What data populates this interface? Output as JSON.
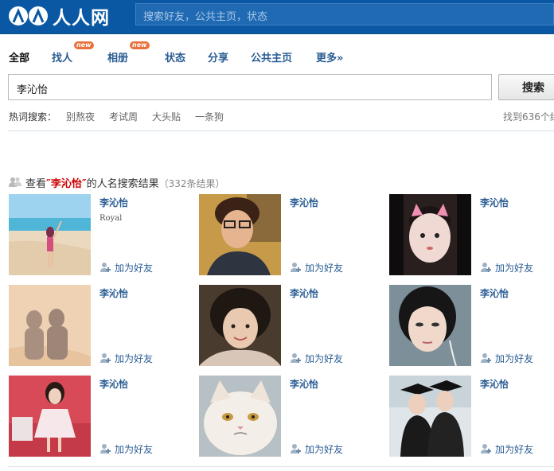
{
  "header": {
    "logo_text": "人人网",
    "search_placeholder": "搜索好友，公共主页，状态"
  },
  "tabs": [
    {
      "label": "全部",
      "active": true,
      "badge": ""
    },
    {
      "label": "找人",
      "active": false,
      "badge": "new"
    },
    {
      "label": "相册",
      "active": false,
      "badge": "new"
    },
    {
      "label": "状态",
      "active": false,
      "badge": ""
    },
    {
      "label": "分享",
      "active": false,
      "badge": ""
    },
    {
      "label": "公共主页",
      "active": false,
      "badge": ""
    },
    {
      "label": "更多»",
      "active": false,
      "badge": ""
    }
  ],
  "search": {
    "value": "李沁怡",
    "button_label": "搜索"
  },
  "hot": {
    "label": "热词搜索：",
    "words": [
      "别熬夜",
      "考试周",
      "大头贴",
      "一条狗"
    ],
    "found_text": "找到636个结"
  },
  "results": {
    "prefix": "查看",
    "name": "″李沁怡″",
    "suffix": "的人名搜索结果",
    "count": "（332条结果）"
  },
  "add_friend_label": "加为好友",
  "people": [
    {
      "name": "李沁怡",
      "subtitle": "Royal",
      "photo": "beach-girl-photo"
    },
    {
      "name": "李沁怡",
      "subtitle": "",
      "photo": "boy-glasses-photo"
    },
    {
      "name": "李沁怡",
      "subtitle": "",
      "photo": "cat-ears-selfie-photo"
    },
    {
      "name": "李沁怡",
      "subtitle": "",
      "photo": "shadow-couple-photo"
    },
    {
      "name": "李沁怡",
      "subtitle": "",
      "photo": "girl-smile-photo"
    },
    {
      "name": "李沁怡",
      "subtitle": "",
      "photo": "girl-closeup-photo"
    },
    {
      "name": "李沁怡",
      "subtitle": "",
      "photo": "girl-pink-dress-photo"
    },
    {
      "name": "李沁怡",
      "subtitle": "",
      "photo": "persian-cat-photo"
    },
    {
      "name": "李沁怡",
      "subtitle": "",
      "photo": "graduates-photo"
    }
  ]
}
